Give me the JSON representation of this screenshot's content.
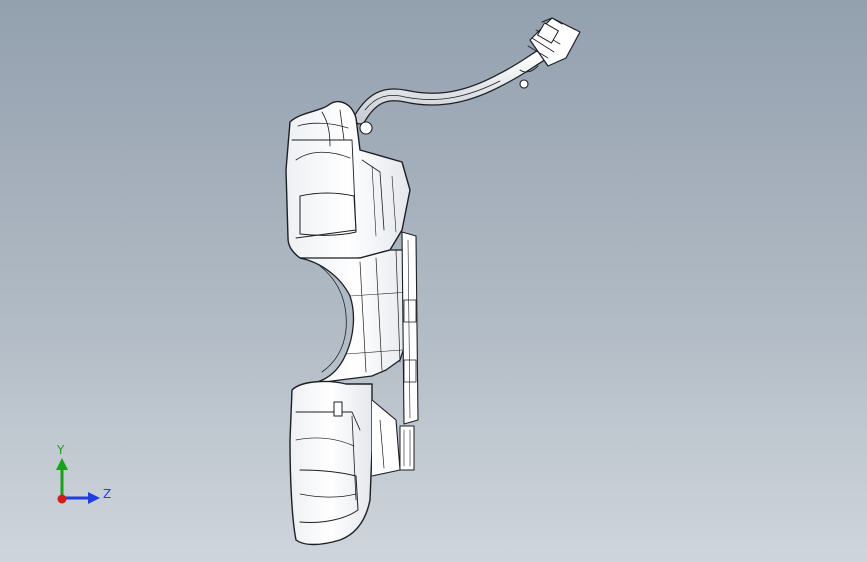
{
  "viewport": {
    "background_top": "#93a0ae",
    "background_bottom": "#cfd5dc",
    "model_stroke": "#1c1f24",
    "model_fill": "#f7f8fa"
  },
  "triad": {
    "x_label": "",
    "y_label": "Y",
    "z_label": "Z",
    "y_color": "#1aa11a",
    "z_color": "#1f3fe0",
    "x_color": "#d61a1a"
  }
}
